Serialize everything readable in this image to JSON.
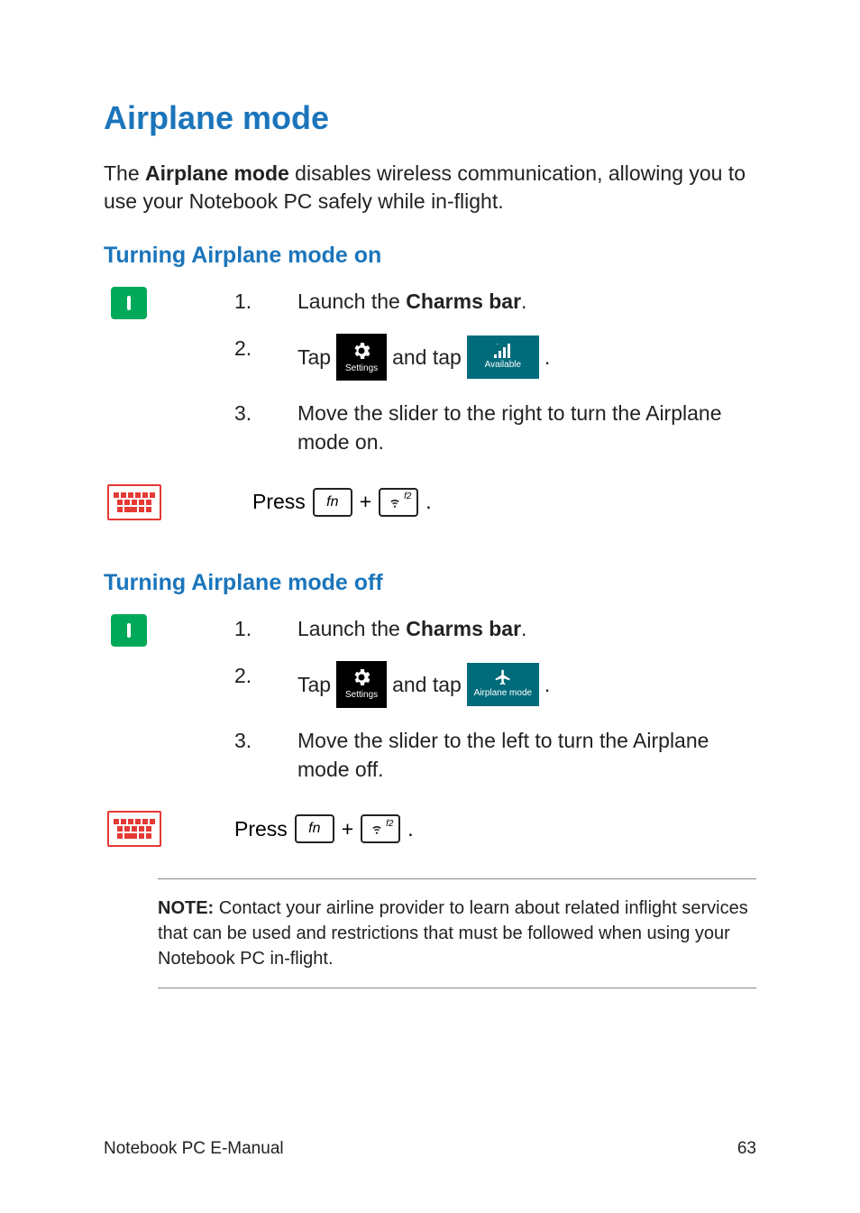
{
  "title": "Airplane mode",
  "intro_pre": "The ",
  "intro_bold": "Airplane mode",
  "intro_post": " disables wireless communication, allowing you to use your Notebook PC safely while in-flight.",
  "section_on": {
    "heading": "Turning Airplane mode on",
    "step1_pre": "Launch the ",
    "step1_bold": "Charms bar",
    "step1_post": ".",
    "step2_tap": "Tap",
    "step2_andtap": "and tap",
    "step2_end": ".",
    "settings_label": "Settings",
    "available_label": "Available",
    "step3": "Move the slider to the right to turn the Airplane mode on.",
    "press": "Press",
    "fn": "fn",
    "f2": "f2",
    "plus": "+",
    "period": "."
  },
  "section_off": {
    "heading": "Turning Airplane mode off",
    "step1_pre": "Launch the ",
    "step1_bold": "Charms bar",
    "step1_post": ".",
    "step2_tap": "Tap",
    "step2_andtap": "and tap",
    "step2_end": ".",
    "settings_label": "Settings",
    "airplane_label": "Airplane mode",
    "step3": "Move the slider to the left to turn the Airplane mode off.",
    "press": "Press",
    "fn": "fn",
    "f2": "f2",
    "plus": "+",
    "period": "."
  },
  "note_label": "NOTE:",
  "note_text": " Contact your airline provider to learn about related inflight services that can be used and restrictions that must be followed when using your Notebook PC in-flight.",
  "footer_left": "Notebook PC E-Manual",
  "footer_right": "63",
  "nums": {
    "n1": "1.",
    "n2": "2.",
    "n3": "3."
  }
}
